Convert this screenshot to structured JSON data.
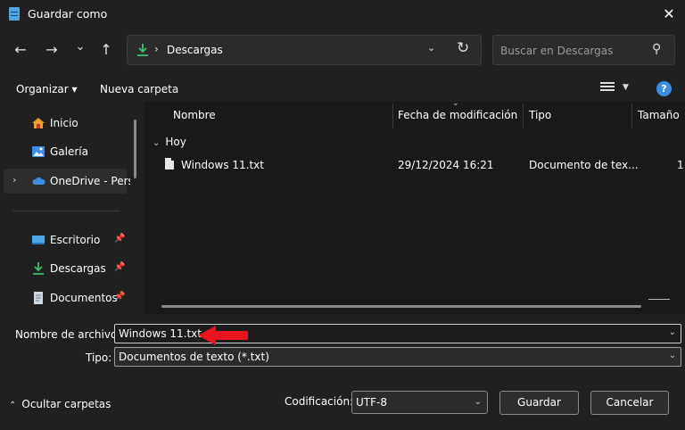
{
  "window": {
    "title": "Guardar como",
    "close": "✕"
  },
  "nav": {
    "back": "←",
    "forward": "→",
    "recent": "⌄",
    "up": "↑"
  },
  "address": {
    "separator": "›",
    "path": "Descargas",
    "dropdown": "⌄",
    "refresh": "↻"
  },
  "search": {
    "placeholder": "Buscar en Descargas",
    "icon": "⚲"
  },
  "toolbar": {
    "organize": "Organizar ▾",
    "new_folder": "Nueva carpeta",
    "help": "?"
  },
  "sidebar": {
    "items": [
      {
        "label": "Inicio"
      },
      {
        "label": "Galería"
      },
      {
        "label": "OneDrive - Personal",
        "expand": "›"
      },
      {
        "label": "Escritorio",
        "pin": "📌"
      },
      {
        "label": "Descargas",
        "pin": "📌"
      },
      {
        "label": "Documentos",
        "pin": "📌"
      }
    ]
  },
  "columns": {
    "name": "Nombre",
    "modified": "Fecha de modificación",
    "type": "Tipo",
    "size": "Tamaño",
    "sort": "⌄"
  },
  "group": {
    "label": "Hoy",
    "chevron": "⌄"
  },
  "files": [
    {
      "name": "Windows 11.txt",
      "modified": "29/12/2024 16:21",
      "type": "Documento de tex...",
      "size": "1"
    }
  ],
  "form": {
    "filename_label": "Nombre de archivo:",
    "filename_value": "Windows 11.txt",
    "type_label": "Tipo:",
    "type_value": "Documentos de texto (*.txt)",
    "dropdown": "⌄",
    "hide_folders": "Ocultar carpetas",
    "hide_caret": "⌃",
    "encoding_label": "Codificación:",
    "encoding_value": "UTF-8",
    "save": "Guardar",
    "cancel": "Cancelar"
  },
  "colors": {
    "accent": "#3a8ee6",
    "arrow": "#e8141e",
    "background": "#202020",
    "list_background": "#191919"
  }
}
